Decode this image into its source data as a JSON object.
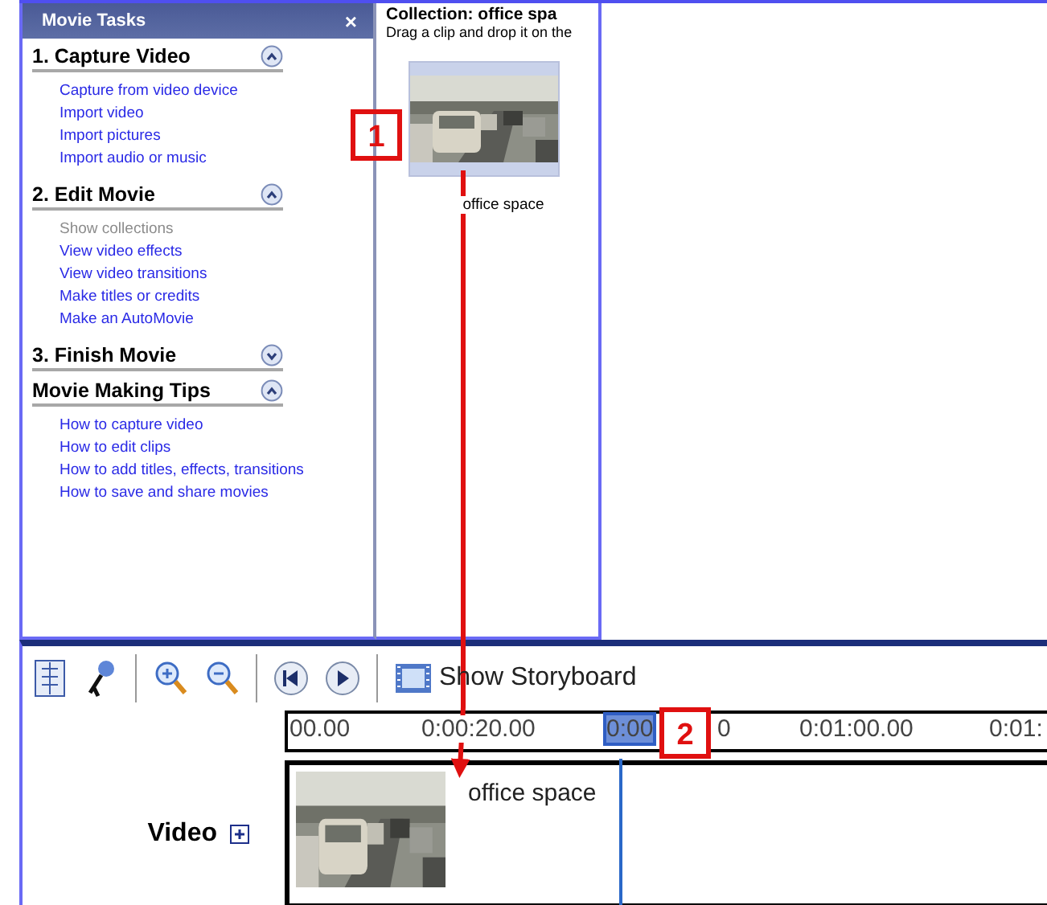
{
  "task_pane": {
    "title": "Movie Tasks",
    "close": "×",
    "sections": [
      {
        "title": "1. Capture Video",
        "expanded": true,
        "links": [
          {
            "label": "Capture from video device",
            "disabled": false
          },
          {
            "label": "Import video",
            "disabled": false
          },
          {
            "label": "Import pictures",
            "disabled": false
          },
          {
            "label": "Import audio or music",
            "disabled": false
          }
        ]
      },
      {
        "title": "2. Edit Movie",
        "expanded": true,
        "links": [
          {
            "label": "Show collections",
            "disabled": true
          },
          {
            "label": "View video effects",
            "disabled": false
          },
          {
            "label": "View video transitions",
            "disabled": false
          },
          {
            "label": "Make titles or credits",
            "disabled": false
          },
          {
            "label": "Make an AutoMovie",
            "disabled": false
          }
        ]
      },
      {
        "title": "3. Finish Movie",
        "expanded": false
      },
      {
        "title": "Movie Making Tips",
        "expanded": true,
        "links": [
          {
            "label": "How to capture video",
            "disabled": false
          },
          {
            "label": "How to edit clips",
            "disabled": false
          },
          {
            "label": "How to add titles, effects, transitions",
            "disabled": false
          },
          {
            "label": "How to save and share movies",
            "disabled": false
          }
        ]
      }
    ]
  },
  "collection": {
    "title": "Collection: office spa",
    "hint": "Drag a clip and drop it on the",
    "clips": [
      {
        "label": "office space",
        "kind": "picture"
      }
    ]
  },
  "toolbar": {
    "storyboard_label": "Show Storyboard"
  },
  "timeline": {
    "ticks": [
      {
        "label": "00.00",
        "current": false
      },
      {
        "label": "0:00:20.00",
        "current": false
      },
      {
        "label": "0:00",
        "current": true
      },
      {
        "label": "0",
        "current": false
      },
      {
        "label": "0:01:00.00",
        "current": false
      },
      {
        "label": "0:01:",
        "current": false
      }
    ]
  },
  "track": {
    "label": "Video",
    "clips": [
      {
        "label": "office space",
        "kind": "picture"
      }
    ]
  },
  "callouts": [
    {
      "number": "1"
    },
    {
      "number": "2"
    }
  ]
}
